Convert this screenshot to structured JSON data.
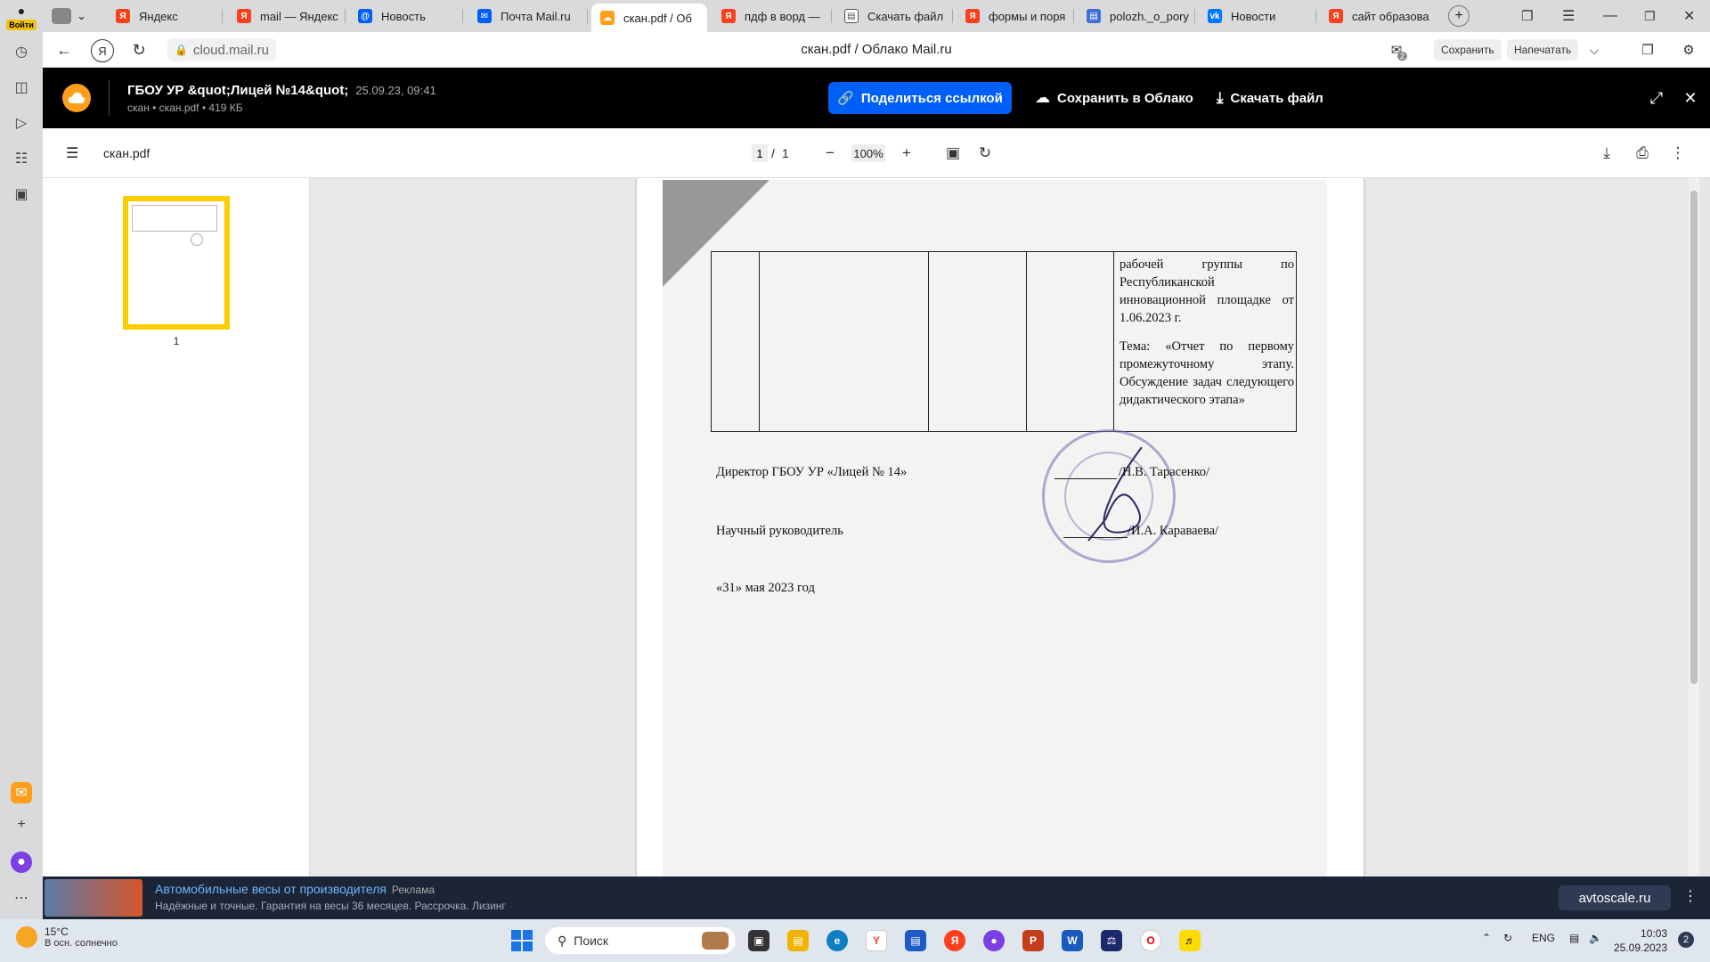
{
  "browser_sidebar": {
    "login_label": "Войти"
  },
  "tabs": [
    {
      "label": "Яндекс",
      "icon": "yandex-icon",
      "color": "#fc3f1d"
    },
    {
      "label": "mail — Яндекс",
      "icon": "yandex-icon",
      "color": "#fc3f1d"
    },
    {
      "label": "Новость",
      "icon": "mail-at-icon",
      "color": "#005ff9"
    },
    {
      "label": "Почта Mail.ru",
      "icon": "mail-envelope-icon",
      "color": "#005ff9"
    },
    {
      "label": "скан.pdf / Об",
      "icon": "cloud-icon",
      "color": "#ff9e1b",
      "active": true
    },
    {
      "label": "пдф в ворд —",
      "icon": "yandex-icon",
      "color": "#fc3f1d"
    },
    {
      "label": "Скачать файл",
      "icon": "document-icon",
      "color": "#555555"
    },
    {
      "label": "формы и поря",
      "icon": "yandex-icon",
      "color": "#fc3f1d"
    },
    {
      "label": "polozh._o_pory",
      "icon": "doc-blue-icon",
      "color": "#3d6fd8"
    },
    {
      "label": "Новости",
      "icon": "vk-icon",
      "color": "#0077ff"
    },
    {
      "label": "сайт образова",
      "icon": "yandex-icon",
      "color": "#fc3f1d"
    }
  ],
  "address_bar": {
    "url": "cloud.mail.ru",
    "page_title": "скан.pdf / Облако Mail.ru",
    "save_label": "Сохранить",
    "print_label": "Напечатать",
    "badge_count": "2"
  },
  "viewer_header": {
    "title": "ГБОУ УР &quot;Лицей №14&quot;",
    "date": "25.09.23, 09:41",
    "subtitle": "скан • скан.pdf • 419 КБ",
    "share_label": "Поделиться ссылкой",
    "save_cloud_label": "Сохранить в Облако",
    "download_label": "Скачать файл"
  },
  "pdf_toolbar": {
    "filename": "скан.pdf",
    "current_page": "1",
    "separator": "/",
    "total_pages": "1",
    "zoom": "100%"
  },
  "thumbnails": [
    {
      "page_label": "1"
    }
  ],
  "document": {
    "cell_paragraph_1": "рабочей группы по Республиканской инновационной площадке от 1.06.2023 г.",
    "cell_paragraph_2": "Тема: «Отчет по первому промежуточному этапу. Обсуждение задач следующего дидактического этапа»",
    "director_role": "Директор ГБОУ УР «Лицей № 14»",
    "director_name": "/Н.В. Тарасенко/",
    "supervisor_role": "Научный руководитель",
    "supervisor_name": "/И.А. Караваева/",
    "date_line": "«31»  мая  2023 год"
  },
  "ad": {
    "headline": "Автомобильные весы от производителя",
    "ad_tag": "Реклама",
    "description": "Надёжные и точные. Гарантия на весы 36 месяцев. Рассрочка. Лизинг",
    "site": "avtoscale.ru"
  },
  "taskbar": {
    "temperature": "15°C",
    "weather_text": "В осн. солнечно",
    "search_label": "Поиск",
    "language": "ENG",
    "time": "10:03",
    "date": "25.09.2023",
    "notification_count": "2"
  }
}
